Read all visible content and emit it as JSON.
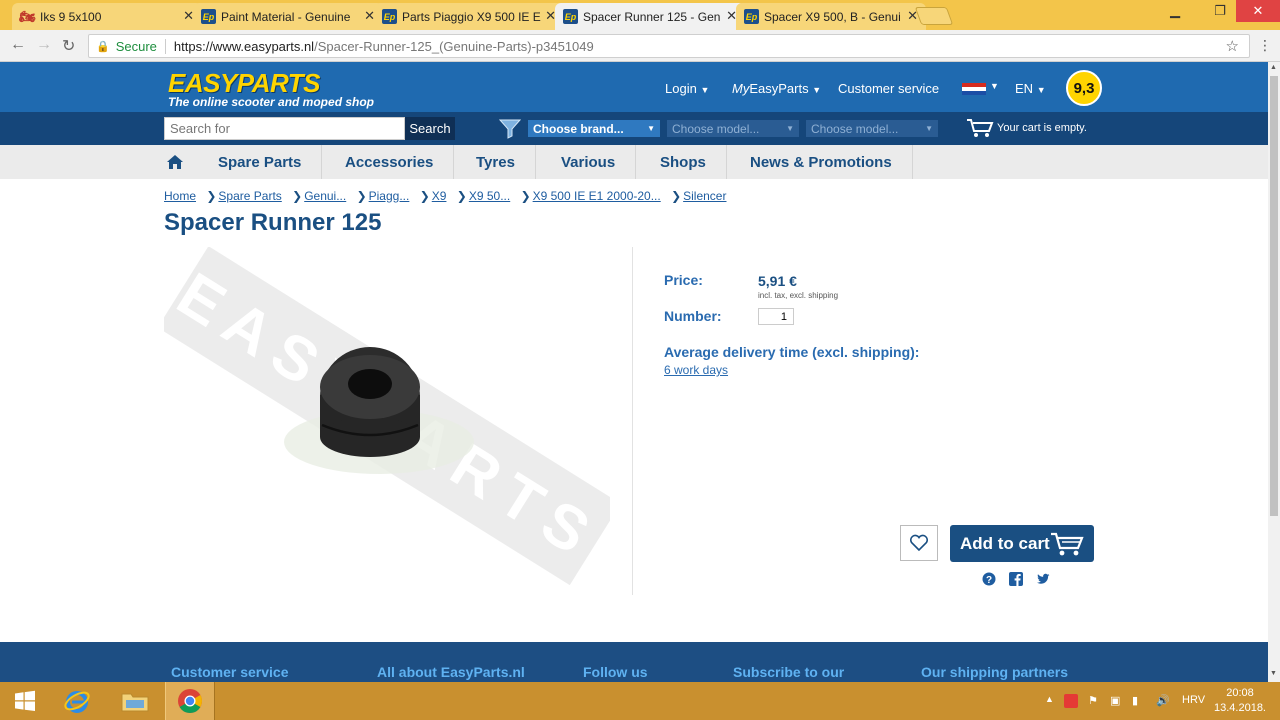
{
  "browser": {
    "tabs": [
      {
        "title": "Iks 9 5x100",
        "icon": "motorcycle-icon"
      },
      {
        "title": "Paint Material - Genuine",
        "icon": "easyparts-favicon"
      },
      {
        "title": "Parts Piaggio X9 500 IE E",
        "icon": "easyparts-favicon"
      },
      {
        "title": "Spacer Runner 125 - Gen",
        "icon": "easyparts-favicon",
        "active": true
      },
      {
        "title": "Spacer X9 500, B - Genui",
        "icon": "easyparts-favicon"
      }
    ],
    "secure_label": "Secure",
    "url_host": "https://www.easyparts.nl",
    "url_path": "/Spacer-Runner-125_(Genuine-Parts)-p3451049"
  },
  "header": {
    "logo": "EASYPARTS",
    "tagline": "The online scooter and moped shop",
    "login": "Login",
    "myeasyparts_prefix": "My",
    "myeasyparts": "EasyParts",
    "customer_service": "Customer service",
    "language": "EN",
    "rating": "9,3",
    "search_placeholder": "Search for",
    "search_button": "Search",
    "choose_brand": "Choose brand...",
    "choose_model_1": "Choose model...",
    "choose_model_2": "Choose model...",
    "cart_status": "Your cart is empty."
  },
  "nav": {
    "items": [
      "Spare Parts",
      "Accessories",
      "Tyres",
      "Various",
      "Shops",
      "News & Promotions"
    ]
  },
  "breadcrumbs": [
    "Home",
    "Spare Parts",
    "Genui...",
    "Piagg...",
    "X9",
    "X9 50...",
    "X9 500 IE E1 2000-20...",
    "Silencer"
  ],
  "product": {
    "title": "Spacer Runner 125",
    "watermark": "EASYPARTS",
    "price_label": "Price:",
    "price": "5,91 €",
    "price_note": "incl. tax, excl. shipping",
    "number_label": "Number:",
    "quantity": "1",
    "delivery_label": "Average delivery time (excl. shipping):",
    "delivery_value": "6 work days",
    "add_to_cart": "Add to cart"
  },
  "footer": {
    "headings": [
      "Customer service",
      "All about EasyParts.nl",
      "Follow us",
      "Subscribe to our",
      "Our shipping partners"
    ]
  },
  "taskbar": {
    "language": "HRV",
    "time": "20:08",
    "date": "13.4.2018."
  },
  "colors": {
    "brand_blue": "#1f6ab0",
    "dark_blue": "#15467a",
    "logo_yellow": "#ffd400",
    "taskbar": "#c9902f"
  }
}
